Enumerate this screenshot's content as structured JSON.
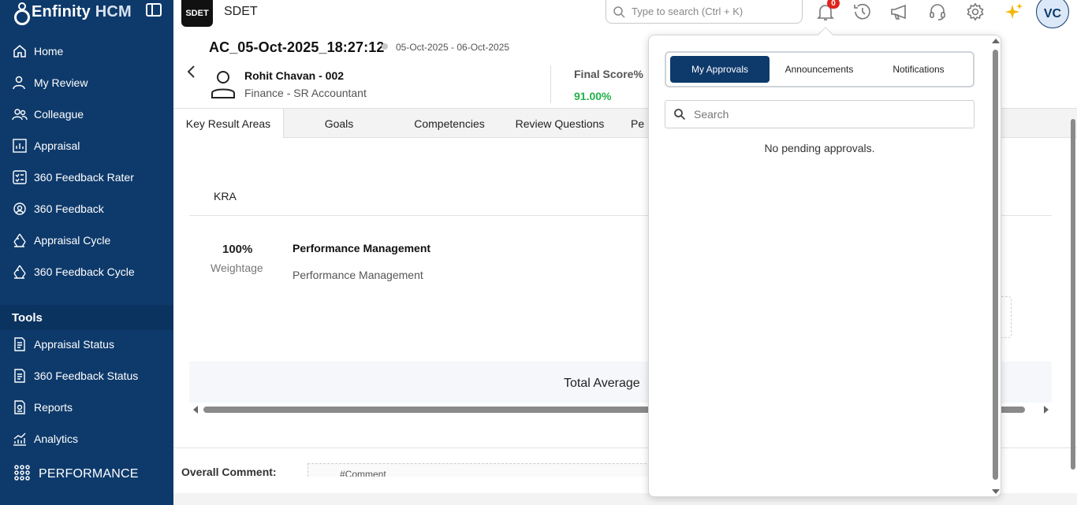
{
  "brand": {
    "name": "Enfinity",
    "suffix": "HCM"
  },
  "sidebar": {
    "items": [
      {
        "label": "Home",
        "icon": "home-icon"
      },
      {
        "label": "My Review",
        "icon": "user-review-icon"
      },
      {
        "label": "Colleague",
        "icon": "people-icon"
      },
      {
        "label": "Appraisal",
        "icon": "grid-chart-icon"
      },
      {
        "label": "360 Feedback Rater",
        "icon": "checklist-icon"
      },
      {
        "label": "360 Feedback",
        "icon": "feedback-icon"
      },
      {
        "label": "Appraisal Cycle",
        "icon": "cycle-icon"
      },
      {
        "label": "360 Feedback Cycle",
        "icon": "cycle-icon"
      }
    ],
    "tools_label": "Tools",
    "tools": [
      {
        "label": "Appraisal Status",
        "icon": "document-icon"
      },
      {
        "label": "360 Feedback Status",
        "icon": "document-icon"
      },
      {
        "label": "Reports",
        "icon": "report-icon"
      },
      {
        "label": "Analytics",
        "icon": "analytics-icon"
      }
    ],
    "module_label": "PERFORMANCE"
  },
  "topbar": {
    "company_logo": "SDET",
    "company_name": "SDET",
    "search_placeholder": "Type to search (Ctrl + K)",
    "notification_count": "0",
    "avatar_initials": "VC"
  },
  "review": {
    "cycle_name": "AC_05-Oct-2025_18:27:12",
    "date_range": "05-Oct-2025 - 06-Oct-2025",
    "employee_name": "Rohit Chavan - 002",
    "employee_role": "Finance - SR Accountant",
    "final_score_label": "Final Score%",
    "final_score_value": "91.00%"
  },
  "tabs": [
    "Key Result Areas",
    "Goals",
    "Competencies",
    "Review Questions",
    "Pe"
  ],
  "kra": {
    "column_header": "KRA",
    "weight_value": "100%",
    "weight_label": "Weightage",
    "title": "Performance Management",
    "description": "Performance Management",
    "total_label": "Total Average"
  },
  "overall_comment_label": "Overall Comment:",
  "overall_comment_value": "#Comment",
  "panel": {
    "tabs": [
      "My Approvals",
      "Announcements",
      "Notifications"
    ],
    "search_placeholder": "Search",
    "empty_message": "No pending approvals."
  },
  "colors": {
    "primary": "#0e3a6b",
    "success": "#22b14c",
    "badge": "#e0241b"
  }
}
